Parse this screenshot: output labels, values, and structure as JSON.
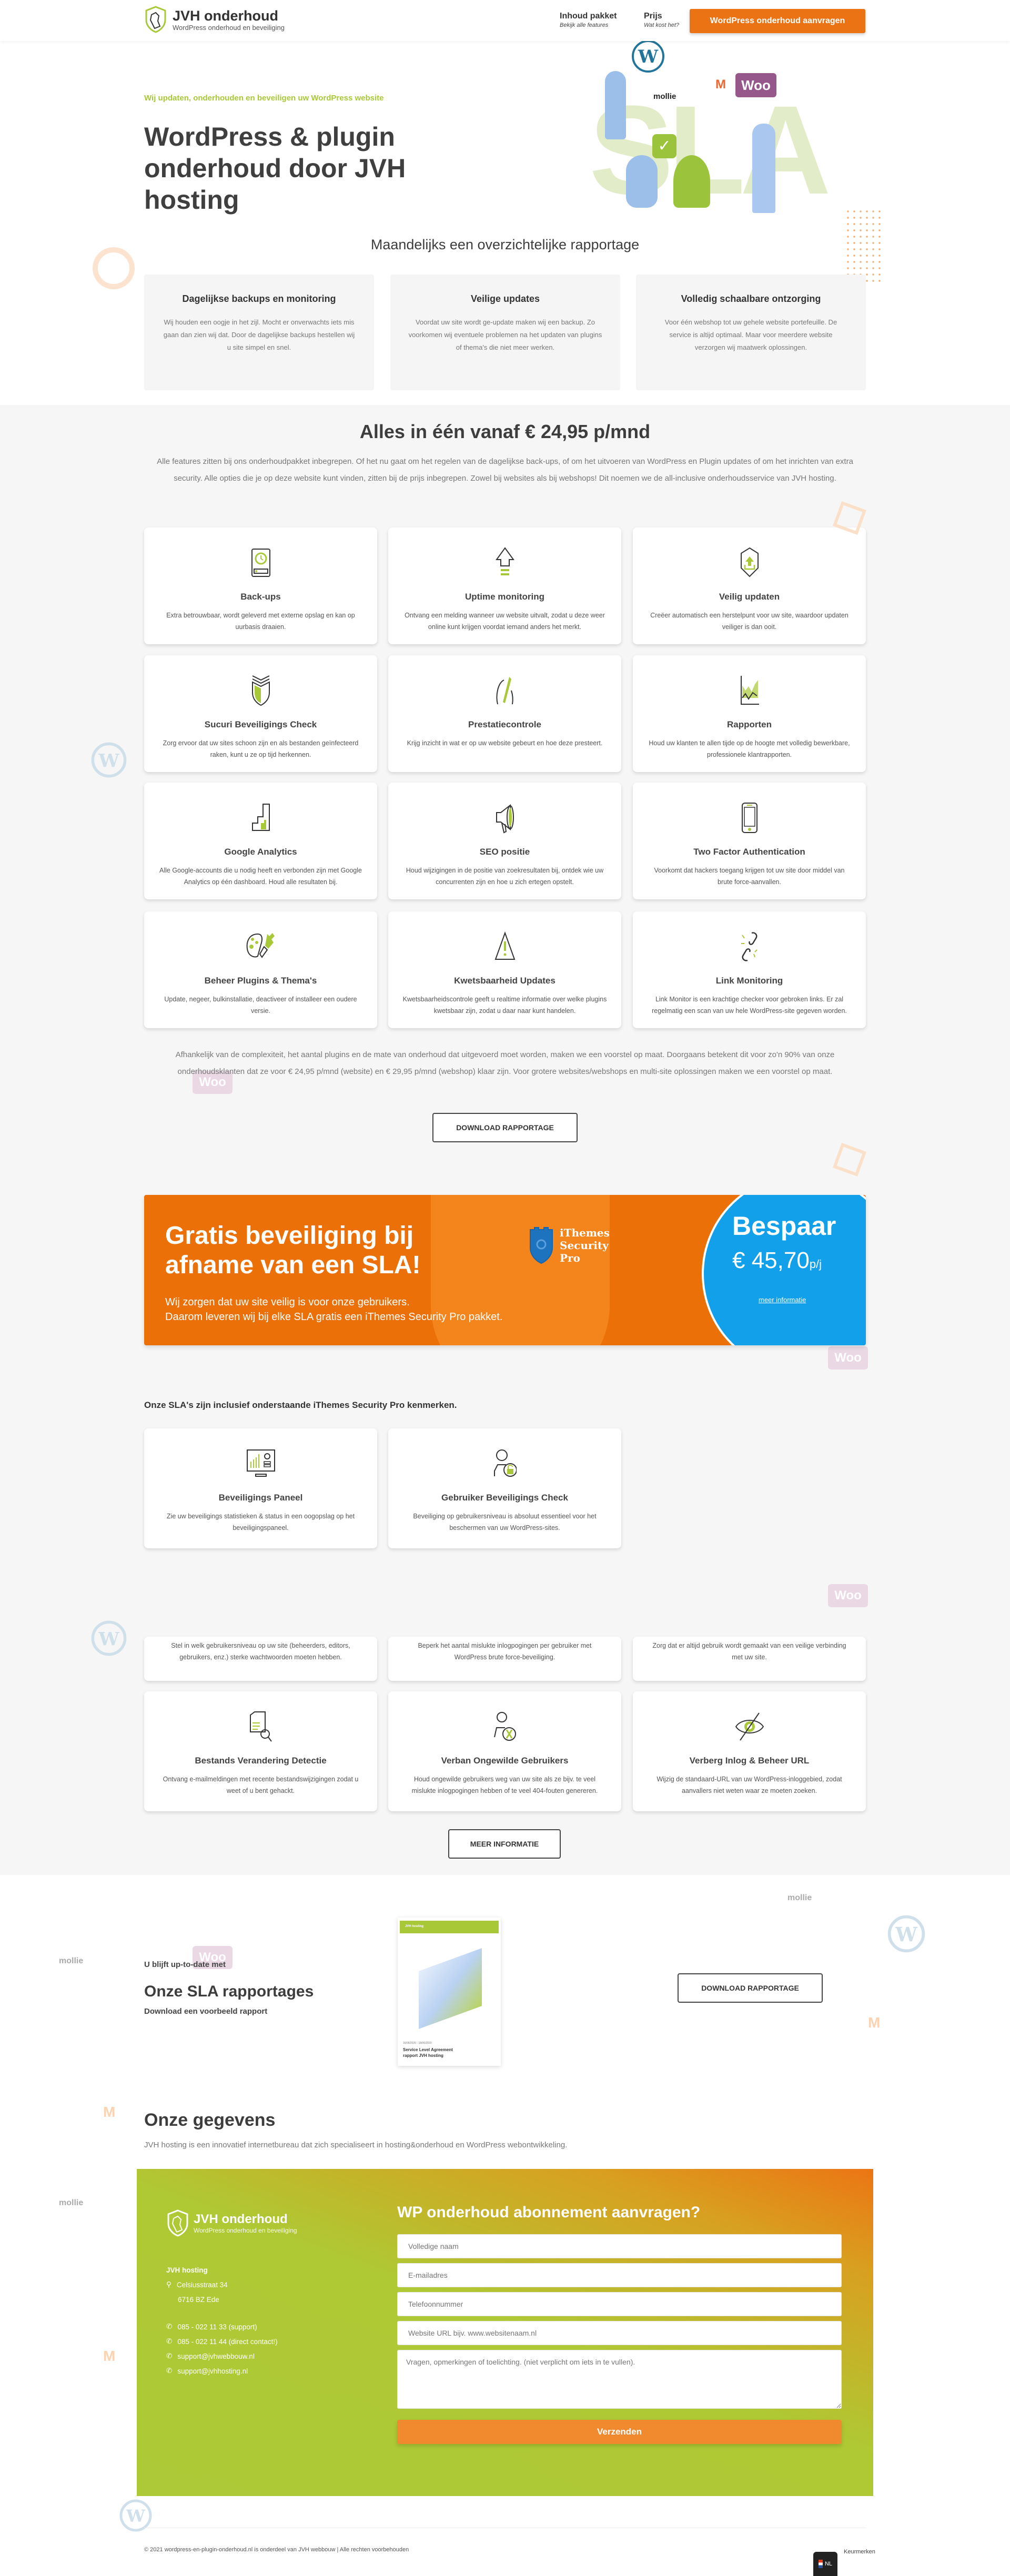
{
  "header": {
    "logo_title": "JVH onderhoud",
    "logo_subtitle": "WordPress onderhoud en beveiliging",
    "nav": [
      {
        "label": "Inhoud pakket",
        "sub": "Bekijk alle features"
      },
      {
        "label": "Prijs",
        "sub": "Wat kost het?"
      }
    ],
    "cta_label": "WordPress onderhoud aanvragen"
  },
  "hero": {
    "kicker": "Wij updaten, onderhouden en beveiligen uw WordPress website",
    "title": "WordPress & plugin onderhoud door JVH hosting",
    "art_labels": {
      "mollie": "mollie",
      "woo": "Woo",
      "sla": "SLA"
    }
  },
  "rapportage": {
    "title": "Maandelijks een overzichtelijke rapportage",
    "cards": [
      {
        "title": "Dagelijkse backups en monitoring",
        "text": "Wij houden een oogje in het zijl. Mocht er onverwachts iets mis gaan dan zien wij dat. Door de dagelijkse backups hestellen wij u site simpel en snel."
      },
      {
        "title": "Veilige updates",
        "text": "Voordat uw site wordt ge-update maken wij een backup. Zo voorkomen wij eventuele problemen na het updaten van plugins of thema's die niet meer werken."
      },
      {
        "title": "Volledig schaalbare ontzorging",
        "text": "Voor één webshop tot uw gehele website portefeuille. De service is altijd optimaal. Maar voor meerdere website verzorgen wij maatwerk oplossingen."
      }
    ]
  },
  "pricing": {
    "title": "Alles in één vanaf € 24,95 p/mnd",
    "intro": "Alle features zitten bij ons onderhoudpakket inbegrepen. Of het nu gaat om het regelen van de dagelijkse back-ups, of om het uitvoeren van WordPress en Plugin updates of om het inrichten van extra security. Alle opties die je op deze website kunt vinden, zitten bij de prijs inbegrepen. Zowel bij websites als bij webshops! Dit noemen we de all-inclusive onderhoudsservice van JVH hosting.",
    "features": [
      {
        "icon": "backup-drive-icon",
        "title": "Back-ups",
        "text": "Extra betrouwbaar, wordt geleverd met externe opslag en kan op uurbasis draaien."
      },
      {
        "icon": "uptime-arrow-icon",
        "title": "Uptime monitoring",
        "text": "Ontvang een melding wanneer uw website uitvalt, zodat u deze weer online kunt krijgen voordat iemand anders het merkt."
      },
      {
        "icon": "shield-upload-icon",
        "title": "Veilig updaten",
        "text": "Creëer automatisch een herstelpunt voor uw site, waardoor updaten veiliger is dan ooit."
      },
      {
        "icon": "sucuri-shield-icon",
        "title": "Sucuri Beveiligings Check",
        "text": "Zorg ervoor dat uw sites schoon zijn en als bestanden geïnfecteerd raken, kunt u ze op tijd herkennen."
      },
      {
        "icon": "speed-gauge-icon",
        "title": "Prestatiecontrole",
        "text": "Krijg inzicht in wat er op uw website gebeurt en hoe deze presteert."
      },
      {
        "icon": "report-chart-icon",
        "title": "Rapporten",
        "text": "Houd uw klanten te allen tijde op de hoogte met volledig bewerkbare, professionele klantrapporten."
      },
      {
        "icon": "analytics-steps-icon",
        "title": "Google Analytics",
        "text": "Alle Google-accounts die u nodig heeft en verbonden zijn met Google Analytics op één dashboard. Houd alle resultaten bij."
      },
      {
        "icon": "megaphone-icon",
        "title": "SEO positie",
        "text": "Houd wijzigingen in de positie van zoekresultaten bij, ontdek wie uw concurrenten zijn en hoe u zich ertegen opstelt."
      },
      {
        "icon": "smartphone-icon",
        "title": "Two Factor Authentication",
        "text": "Voorkomt dat hackers toegang krijgen tot uw site door middel van brute force-aanvallen."
      },
      {
        "icon": "palette-brush-icon",
        "title": "Beheer Plugins & Thema's",
        "text": "Update, negeer, bulkinstallatie, deactiveer of installeer een oudere versie."
      },
      {
        "icon": "warning-triangle-icon",
        "title": "Kwetsbaarheid Updates",
        "text": "Kwetsbaarheidscontrole geeft u realtime informatie over welke plugins kwetsbaar zijn, zodat u daar naar kunt handelen."
      },
      {
        "icon": "broken-link-icon",
        "title": "Link Monitoring",
        "text": "Link Monitor is een krachtige checker voor gebroken links. Er zal regelmatig een scan van uw hele WordPress-site gegeven worden."
      }
    ],
    "outro": "Afhankelijk van de complexiteit, het aantal plugins en de mate van onderhoud dat uitgevoerd moet worden, maken we een voorstel op maat. Doorgaans betekent dit voor zo'n 90% van onze onderhoudsklanten dat ze voor € 24,95 p/mnd (website) en € 29,95 p/mnd (webshop) klaar zijn. Voor grotere websites/webshops en multi-site oplossingen maken we een voorstel op maat.",
    "download_label": "DOWNLOAD RAPPORTAGE"
  },
  "banner": {
    "title": "Gratis beveiliging bij afname van een SLA!",
    "text_line1": "Wij zorgen dat uw site veilig is voor onze gebruikers.",
    "text_line2": "Daarom leveren wij bij elke SLA gratis een iThemes Security Pro pakket.",
    "logo_text": "iThemes Security Pro",
    "bespaar": "Bespaar",
    "price": "€ 45,70",
    "price_unit": "p/j",
    "link": "meer informatie",
    "colors": {
      "orange": "#eb7008",
      "blue": "#12a0ea"
    }
  },
  "security": {
    "title": "Onze SLA's zijn inclusief onderstaande iThemes Security Pro kenmerken.",
    "features_top": [
      {
        "icon": "security-dashboard-icon",
        "title": "Beveiligings Paneel",
        "text": "Zie uw beveiligings statistieken & status in een oogopslag op het beveiligingspaneel."
      },
      {
        "icon": "user-lock-icon",
        "title": "Gebruiker Beveiligings Check",
        "text": "Beveiliging op gebruikersniveau is absoluut essentieel voor het beschermen van uw WordPress-sites."
      }
    ],
    "features_partial": [
      {
        "text": "Stel in welk gebruikersniveau op uw site (beheerders, editors, gebruikers, enz.) sterke wachtwoorden moeten hebben."
      },
      {
        "text": "Beperk het aantal mislukte inlogpogingen per gebruiker met WordPress brute force-beveiliging."
      },
      {
        "text": "Zorg dat er altijd gebruik wordt gemaakt van een veilige verbinding met uw site."
      }
    ],
    "features_bottom": [
      {
        "icon": "file-search-icon",
        "title": "Bestands Verandering Detectie",
        "text": "Ontvang e-mailmeldingen met recente bestandswijzigingen zodat u weet of u bent gehackt."
      },
      {
        "icon": "user-ban-icon",
        "title": "Verban Ongewilde Gebruikers",
        "text": "Houd ongewilde gebruikers weg van uw site als ze bijv. te veel mislukte inlogpogingen hebben of te veel 404-fouten genereren."
      },
      {
        "icon": "hidden-eye-icon",
        "title": "Verberg Inlog & Beheer URL",
        "text": "Wijzig de standaard-URL van uw WordPress-inloggebied, zodat aanvallers niet weten waar ze moeten zoeken."
      }
    ],
    "more_label": "MEER INFORMATIE"
  },
  "sla_report": {
    "kicker": "U blijft up-to-date met",
    "title": "Onze SLA rapportages",
    "subtitle": "Download een voorbeeld rapport",
    "doc_title": "Service Level Agreement rapport JVH hosting",
    "doc_date": "16/06/2020 - 18/06/2020",
    "doc_brand": "JVH hosting",
    "download_label": "DOWNLOAD RAPPORTAGE"
  },
  "contact": {
    "title": "Onze gegevens",
    "text": "JVH hosting is een innovatief internetbureau dat zich specialiseert in hosting&onderhoud en WordPress webontwikkeling.",
    "logo_title": "JVH onderhoud",
    "logo_subtitle": "WordPress onderhoud en beveiliging",
    "company": "JVH hosting",
    "street": "Celsiusstraat 34",
    "city": "6716 BZ Ede",
    "phone_support": "085 - 022 11 33  (support)",
    "phone_direct": "085 - 022 11 44  (direct contact!)",
    "email1": "support@jvhwebbouw.nl",
    "email2": "support@jvhhosting.nl",
    "form": {
      "title": "WP onderhoud abonnement aanvragen?",
      "name_placeholder": "Volledige naam",
      "email_placeholder": "E-mailadres",
      "phone_placeholder": "Telefoonnummer",
      "url_placeholder": "Website URL bijv. www.websitenaam.nl",
      "message_placeholder": "Vragen, opmerkingen of toelichting. (niet verplicht om iets in te vullen).",
      "submit_label": "Verzenden"
    }
  },
  "footer": {
    "copyright": "© 2021 wordpress-en-plugin-onderhoud.nl is onderdeel van JVH webbouw | Alle rechten voorbehouden",
    "kenmerken": "Keurmerken",
    "language": "NL"
  }
}
